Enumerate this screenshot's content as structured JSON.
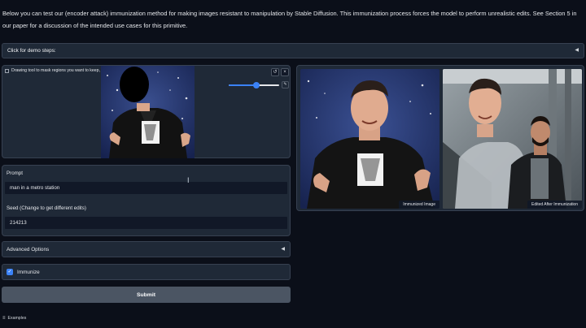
{
  "intro": {
    "text": "Below you can test our (encoder attack) immunization method for making images resistant to manipulation by Stable Diffusion. This immunization process forces the model to perform unrealistic edits. See Section 5 in our paper for a discussion of the intended use cases for this primitive."
  },
  "demo": {
    "label": "Click for demo steps:",
    "icon": "triangle-left-icon"
  },
  "mask_tool": {
    "label": "Drawing tool to mask regions you want to keep, e.g. faces",
    "undo_icon": "↺",
    "clear_icon": "×",
    "brush_icon": "✎",
    "brush_size_fraction": 0.55
  },
  "output": {
    "left_caption": "Immunized Image",
    "right_caption": "Edited After Immunization"
  },
  "prompt": {
    "label": "Prompt",
    "value": "man in a metro station"
  },
  "seed": {
    "label": "Seed (Change to get different edits)",
    "value": "214213"
  },
  "advanced": {
    "label": "Advanced Options",
    "icon": "triangle-left-icon"
  },
  "immunize": {
    "label": "Immunize",
    "checked": true,
    "check_glyph": "✓"
  },
  "submit": {
    "label": "Submit"
  },
  "examples": {
    "label": "Examples",
    "icon": "≡"
  },
  "colors": {
    "background": "#0b0f19",
    "panel": "#1f2937",
    "accent": "#3b82f6",
    "submit": "#4b5563"
  }
}
